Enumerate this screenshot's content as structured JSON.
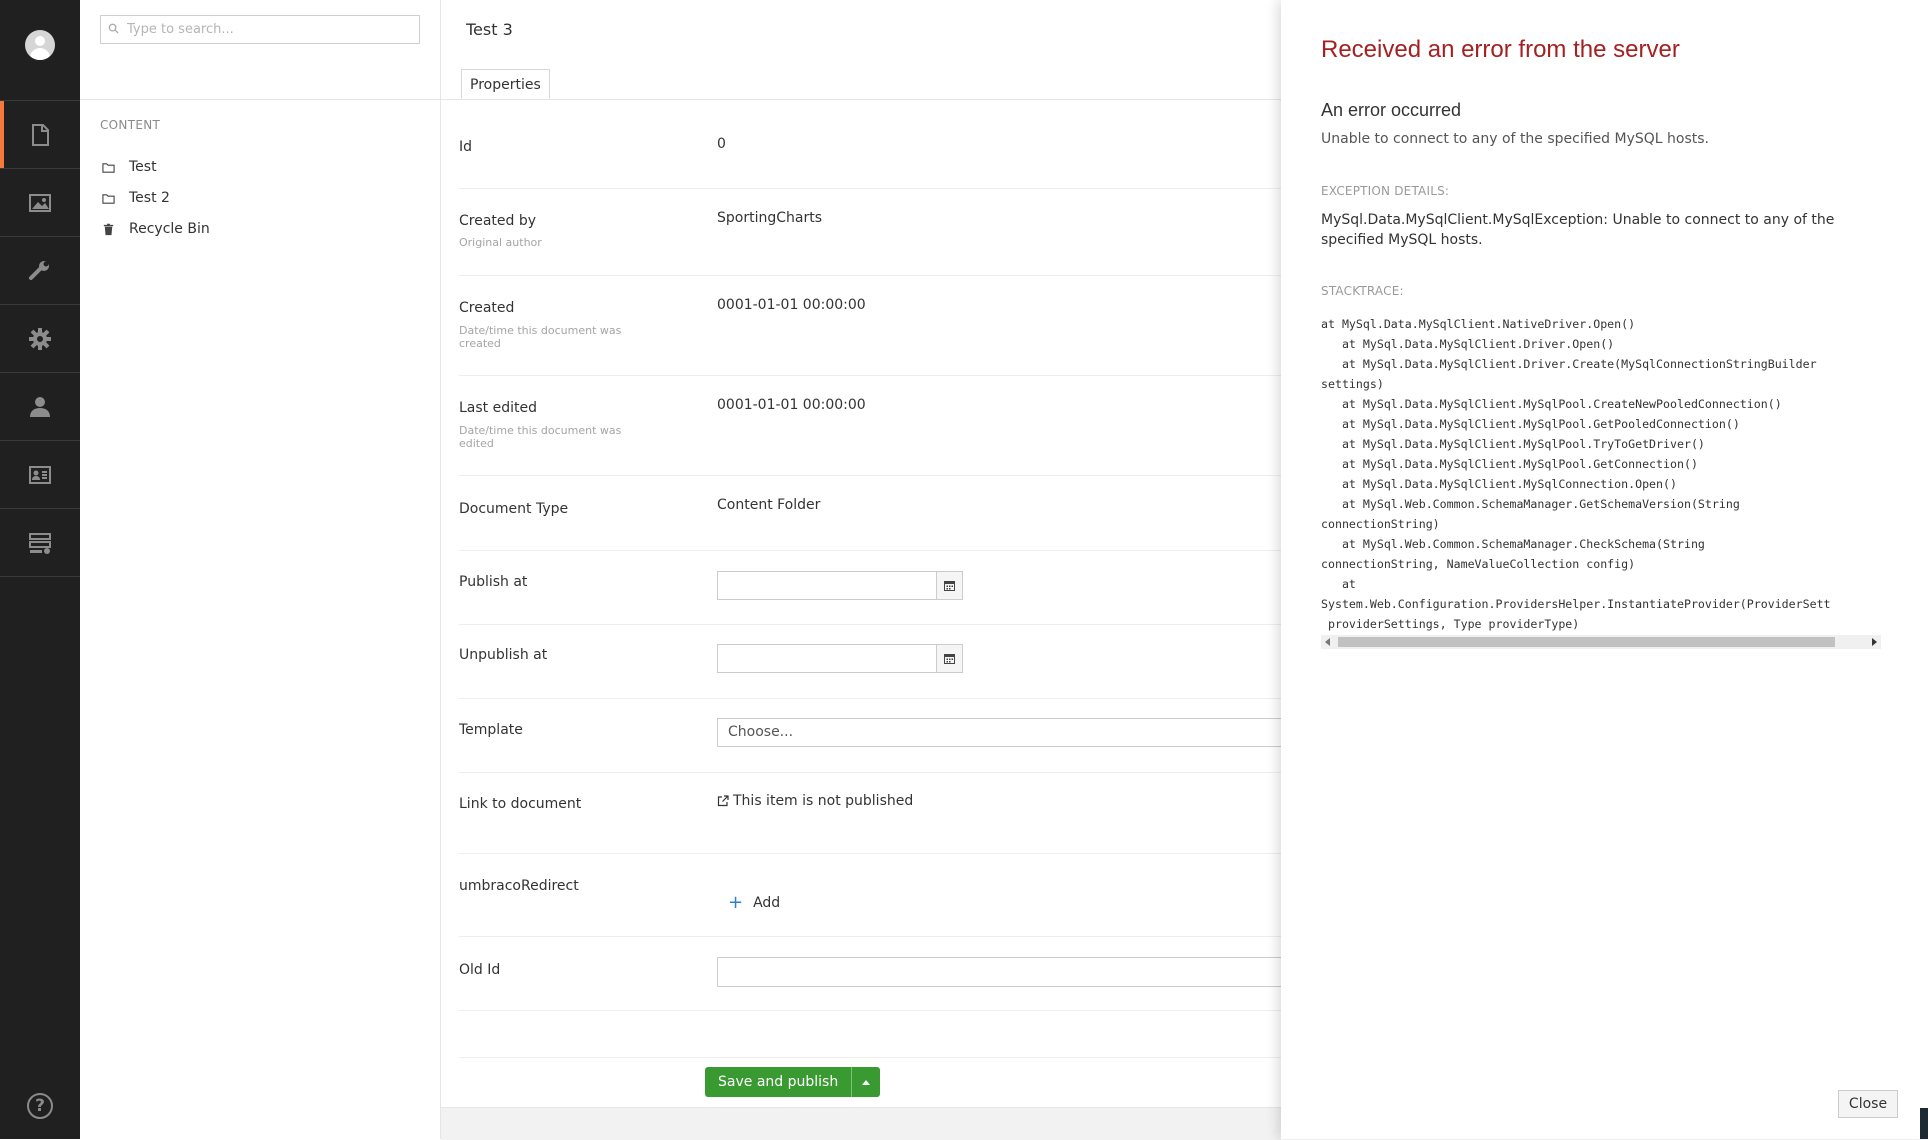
{
  "search": {
    "placeholder": "Type to search..."
  },
  "tree": {
    "section_label": "CONTENT",
    "nodes": [
      {
        "label": "Test",
        "icon": "folder-icon"
      },
      {
        "label": "Test 2",
        "icon": "folder-icon"
      },
      {
        "label": "Recycle Bin",
        "icon": "trash-icon"
      }
    ]
  },
  "rail": {
    "sections": [
      "content-icon",
      "media-icon",
      "settings-wrench-icon",
      "developer-gear-icon",
      "users-icon",
      "members-icon",
      "forms-icon"
    ],
    "accent": "#f5793a"
  },
  "editor": {
    "title": "Test 3",
    "tab": "Properties",
    "properties": {
      "id": {
        "label": "Id",
        "value": "0"
      },
      "created_by": {
        "label": "Created by",
        "description": "Original author",
        "value": "SportingCharts"
      },
      "created": {
        "label": "Created",
        "description": "Date/time this document was created",
        "value": "0001-01-01 00:00:00"
      },
      "last_edited": {
        "label": "Last edited",
        "description": "Date/time this document was edited",
        "value": "0001-01-01 00:00:00"
      },
      "document_type": {
        "label": "Document Type",
        "value": "Content Folder"
      },
      "publish_at": {
        "label": "Publish at"
      },
      "unpublish_at": {
        "label": "Unpublish at"
      },
      "template": {
        "label": "Template",
        "placeholder": "Choose..."
      },
      "link": {
        "label": "Link to document",
        "value": "This item is not published"
      },
      "redirect": {
        "label": "umbracoRedirect",
        "add_label": "Add"
      },
      "old_id": {
        "label": "Old Id"
      }
    },
    "save_label": "Save and publish",
    "save_color": "#3a9a32"
  },
  "error": {
    "title": "Received an error from the server",
    "subtitle": "An error occurred",
    "message": "Unable to connect to any of the specified MySQL hosts.",
    "exception_heading": "EXCEPTION DETAILS:",
    "exception": "MySql.Data.MySqlClient.MySqlException: Unable to connect to any of the specified MySQL hosts.",
    "stack_heading": "STACKTRACE:",
    "stacktrace": "at MySql.Data.MySqlClient.NativeDriver.Open()\n   at MySql.Data.MySqlClient.Driver.Open()\n   at MySql.Data.MySqlClient.Driver.Create(MySqlConnectionStringBuilder\nsettings)\n   at MySql.Data.MySqlClient.MySqlPool.CreateNewPooledConnection()\n   at MySql.Data.MySqlClient.MySqlPool.GetPooledConnection()\n   at MySql.Data.MySqlClient.MySqlPool.TryToGetDriver()\n   at MySql.Data.MySqlClient.MySqlPool.GetConnection()\n   at MySql.Data.MySqlClient.MySqlConnection.Open()\n   at MySql.Web.Common.SchemaManager.GetSchemaVersion(String\nconnectionString)\n   at MySql.Web.Common.SchemaManager.CheckSchema(String\nconnectionString, NameValueCollection config)\n   at\nSystem.Web.Configuration.ProvidersHelper.InstantiateProvider(ProviderSett\n providerSettings, Type providerType)",
    "close_label": "Close",
    "title_color": "#a52121"
  }
}
